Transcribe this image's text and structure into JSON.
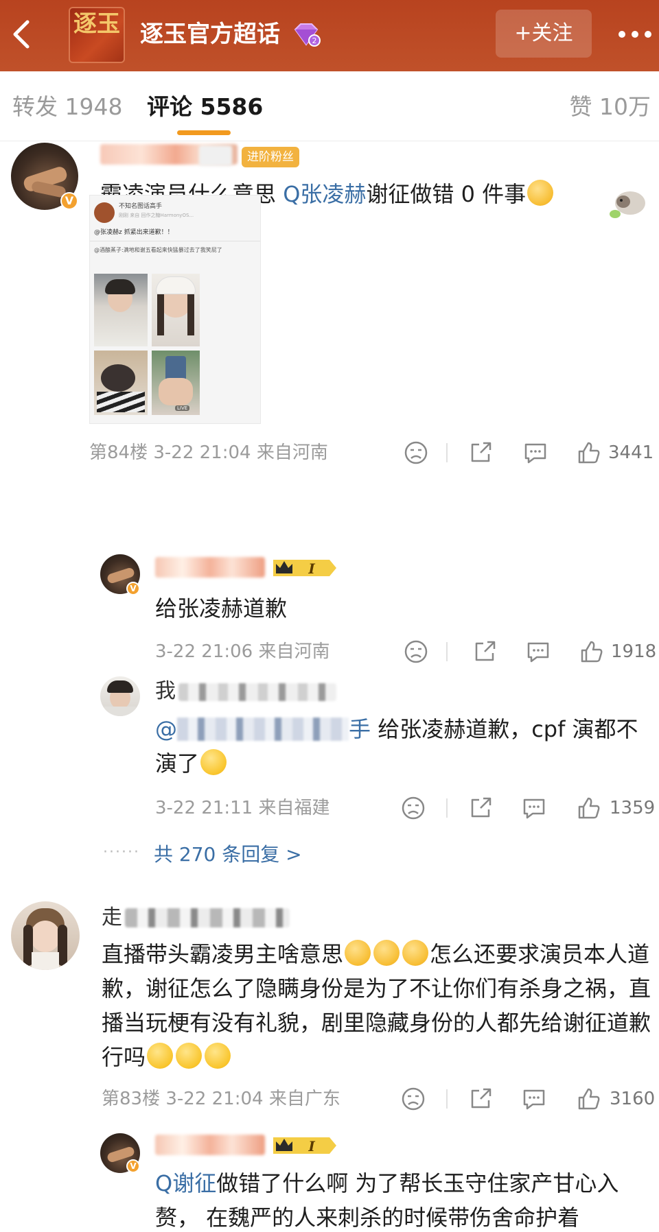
{
  "header": {
    "logo_text": "逐玉",
    "title": "逐玉官方超话",
    "follow_label": "+关注"
  },
  "tabs": {
    "repost": "转发 1948",
    "comment": "评论 5586",
    "like": "赞 10万"
  },
  "comments": [
    {
      "fan_badge": "进阶粉丝",
      "text_prefix": "霸凌演员什么意思 ",
      "link_text": "Q张凌赫",
      "text_suffix": "谢征做错 0 件事",
      "meta": "第84楼 3-22 21:04 来自河南",
      "likes": "3441",
      "embedded_post": {
        "account": "不知名图话高手",
        "source": "刚刚  来自 回作之糖HarmonyOS...",
        "line1": "@张凌赫z 抓紧出来道歉！！",
        "line2": "@酒酿蒸子:满地和谢五看起来快猛暴过去了我笑屁了",
        "live_tag": "LIVE"
      }
    },
    {
      "level_badge": "I",
      "text": "给张凌赫道歉",
      "meta": "3-22 21:06 来自河南",
      "likes": "1918"
    },
    {
      "name_prefix": "我",
      "mention_prefix": "@",
      "mention_suffix": "手",
      "text": "给张凌赫道歉，cpf 演都不演了",
      "meta": "3-22 21:11 来自福建",
      "likes": "1359"
    },
    {
      "name_prefix": "走",
      "text": "直播带头霸凌男主啥意思",
      "text2": "怎么还要求演员本人道歉，谢征怎么了隐瞒身份是为了不让你们有杀身之祸，直播当玩梗有没有礼貌，剧里隐藏身份的人都先给谢征道歉行吗",
      "meta": "第83楼 3-22 21:04 来自广东",
      "likes": "3160"
    },
    {
      "level_badge": "I",
      "link_text": "Q谢征",
      "text": "做错了什么啊 为了帮长玉守住家产甘心入赘， 在魏严的人来刺杀的时候带伤舍命护着"
    }
  ],
  "replies_link": "共 270 条回复 >",
  "colors": {
    "header_bg": "#b8431f",
    "accent_orange": "#f29a1f",
    "link_blue": "#3a6ea5",
    "fan_badge": "#f2b23f"
  },
  "icons": [
    "back-arrow-icon",
    "gem-level-icon",
    "more-dots-icon",
    "dislike-face-icon",
    "share-icon",
    "comment-icon",
    "thumbs-up-icon",
    "verified-v-icon",
    "crown-level-icon",
    "cry-emoji",
    "flushed-emoji",
    "smile-emoji",
    "grumpy-emoji",
    "sheep-sticker-icon"
  ]
}
